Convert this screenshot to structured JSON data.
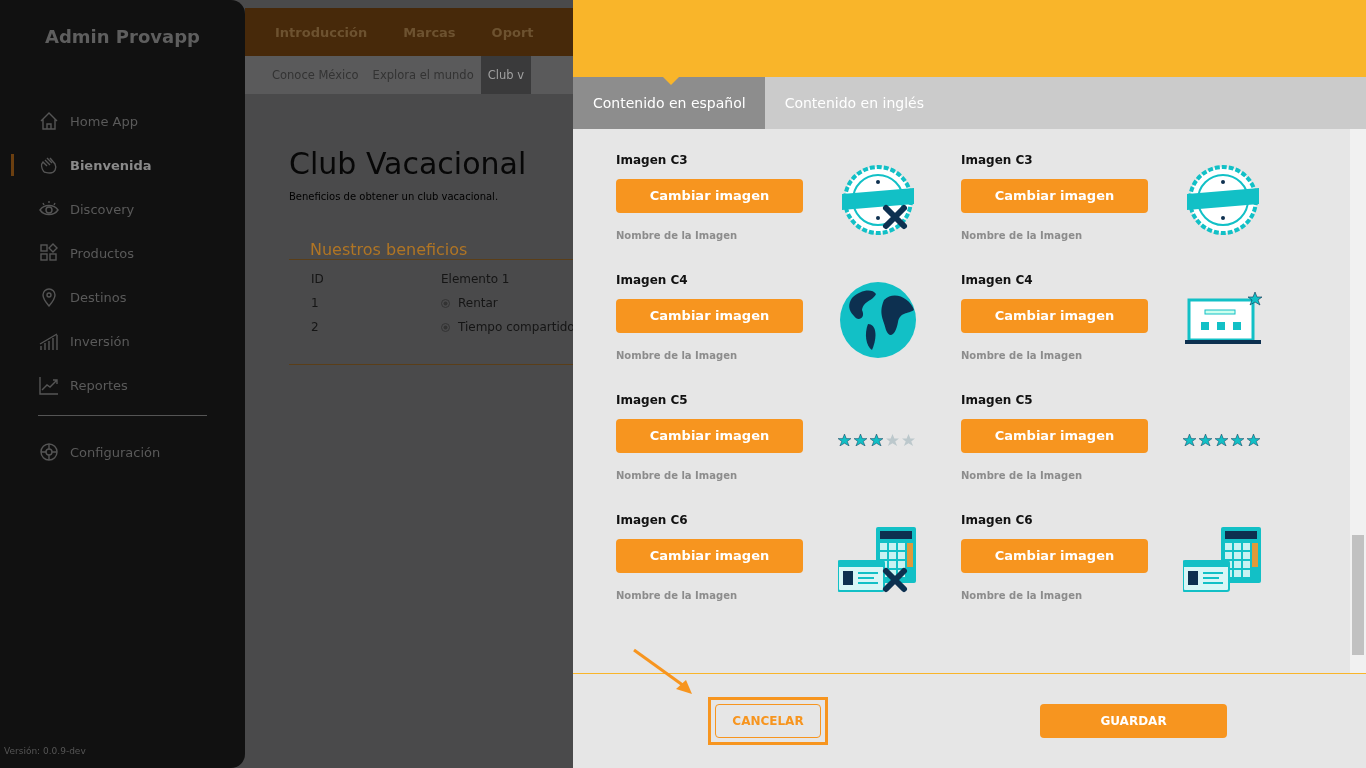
{
  "sidebar": {
    "title": "Admin Provapp",
    "items": [
      {
        "label": "Home App",
        "kind": "home",
        "selected": false
      },
      {
        "label": "Bienvenida",
        "kind": "hand",
        "selected": true
      },
      {
        "label": "Discovery",
        "kind": "eye",
        "selected": false
      },
      {
        "label": "Productos",
        "kind": "grid",
        "selected": false
      },
      {
        "label": "Destinos",
        "kind": "pin",
        "selected": false
      },
      {
        "label": "Inversión",
        "kind": "bars",
        "selected": false
      },
      {
        "label": "Reportes",
        "kind": "trend",
        "selected": false
      }
    ],
    "footer_items": [
      {
        "label": "Configuración",
        "kind": "gear",
        "selected": false
      }
    ],
    "version": "Versión: 0.0.9-dev"
  },
  "top_nav": [
    {
      "label": "Introducción"
    },
    {
      "label": "Marcas"
    },
    {
      "label": "Oport"
    }
  ],
  "sub_nav": [
    {
      "label": "Conoce México",
      "selected": false
    },
    {
      "label": "Explora el mundo",
      "selected": false
    },
    {
      "label": "Club v",
      "selected": true
    }
  ],
  "page": {
    "title": "Club Vacacional",
    "subtitle": "Beneficios de obtener un club vacacional.",
    "section_title": "Nuestros beneficios",
    "table": {
      "columns": [
        "ID",
        "Elemento 1"
      ],
      "rows": [
        [
          "1",
          "Rentar"
        ],
        [
          "2",
          "Tiempo compartido"
        ]
      ]
    }
  },
  "panel": {
    "tabs": [
      {
        "label": "Contenido en español",
        "selected": true
      },
      {
        "label": "Contenido en inglés",
        "selected": false
      }
    ],
    "images": [
      {
        "label": "Imagen C3",
        "button": "Cambiar imagen",
        "caption": "Nombre de la Imagen",
        "kind": "badge",
        "crossed": true
      },
      {
        "label": "Imagen C3",
        "button": "Cambiar imagen",
        "caption": "Nombre de la Imagen",
        "kind": "badge",
        "crossed": false
      },
      {
        "label": "Imagen C4",
        "button": "Cambiar imagen",
        "caption": "Nombre de la Imagen",
        "kind": "globe",
        "crossed": false
      },
      {
        "label": "Imagen C4",
        "button": "Cambiar imagen",
        "caption": "Nombre de la Imagen",
        "kind": "laptop",
        "crossed": false
      },
      {
        "label": "Imagen C5",
        "button": "Cambiar imagen",
        "caption": "Nombre de la Imagen",
        "kind": "rating",
        "stars": 3
      },
      {
        "label": "Imagen C5",
        "button": "Cambiar imagen",
        "caption": "Nombre de la Imagen",
        "kind": "rating",
        "stars": 5
      },
      {
        "label": "Imagen C6",
        "button": "Cambiar imagen",
        "caption": "Nombre de la Imagen",
        "kind": "calculator",
        "crossed": true
      },
      {
        "label": "Imagen C6",
        "button": "Cambiar imagen",
        "caption": "Nombre de la Imagen",
        "kind": "calculator",
        "crossed": false
      }
    ],
    "cancel": "CANCELAR",
    "save": "GUARDAR"
  }
}
